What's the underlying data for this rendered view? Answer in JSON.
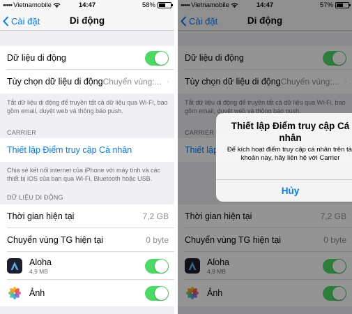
{
  "screens": [
    {
      "status": {
        "carrier": "Vietnamobile",
        "time": "14:47",
        "battery": "58%",
        "battery_level": 0.58
      },
      "nav": {
        "back_label": "Cài đặt",
        "title": "Di động"
      },
      "settings": {
        "mobile_data_label": "Dữ liệu di động",
        "mobile_data_on": true,
        "options_label": "Tùy chọn dữ liệu di động",
        "options_value": "Chuyển vùng:...",
        "footnote_1": "Tắt dữ liệu di động để truyền tất cả dữ liệu qua Wi-Fi, bao gồm email, duyệt web và thông báo push.",
        "carrier_header": "CARRIER",
        "hotspot_label": "Thiết lập Điểm truy cập Cá nhân",
        "footnote_2": "Chia sẻ kết nối internet của iPhone với máy tính và các thiết bị iOS của bạn qua Wi-Fi, Bluetooth hoặc USB.",
        "usage_header": "DỮ LIỆU DI ĐỘNG",
        "current_period_label": "Thời gian hiện tại",
        "current_period_value": "7,2 GB",
        "roaming_label": "Chuyển vùng TG hiện tại",
        "roaming_value": "0 byte",
        "apps": [
          {
            "name": "Aloha",
            "size": "4,9 MB",
            "icon": "aloha-icon",
            "enabled": true
          },
          {
            "name": "Ảnh",
            "size": "",
            "icon": "photos-icon",
            "enabled": true
          }
        ]
      }
    },
    {
      "status": {
        "carrier": "Vietnamobile",
        "time": "14:47",
        "battery": "57%",
        "battery_level": 0.57
      },
      "nav": {
        "back_label": "Cài đặt",
        "title": "Di động"
      },
      "settings": {
        "mobile_data_label": "Dữ liệu di động",
        "mobile_data_on": true,
        "options_label": "Tùy chọn dữ liệu di động",
        "options_value": "Chuyển vùng:...",
        "footnote_1": "Tắt dữ liệu di động để truyền tất cả dữ liệu qua Wi-Fi, bao gồm email, duyệt web và thông báo push.",
        "carrier_header": "CARRIER",
        "hotspot_label": "Thiết lập Điểm truy cập Cá nhân",
        "footnote_2": "",
        "usage_header": "",
        "current_period_label": "Thời gian hiện tại",
        "current_period_value": "7,2 GB",
        "roaming_label": "Chuyển vùng TG hiện tại",
        "roaming_value": "0 byte",
        "apps": [
          {
            "name": "Aloha",
            "size": "4,9 MB",
            "icon": "aloha-icon",
            "enabled": true
          },
          {
            "name": "Ảnh",
            "size": "",
            "icon": "photos-icon",
            "enabled": true
          }
        ]
      },
      "alert": {
        "title": "Thiết lập Điểm truy cập Cá nhân",
        "message": "Để kích hoạt điểm truy cập cá nhân trên tài khoản này, hãy liên hệ với Carrier",
        "button": "Hủy"
      }
    }
  ],
  "colors": {
    "accent": "#007aff",
    "toggle_on": "#4cd964",
    "background": "#efeff4",
    "secondary_text": "#6d6d72"
  }
}
